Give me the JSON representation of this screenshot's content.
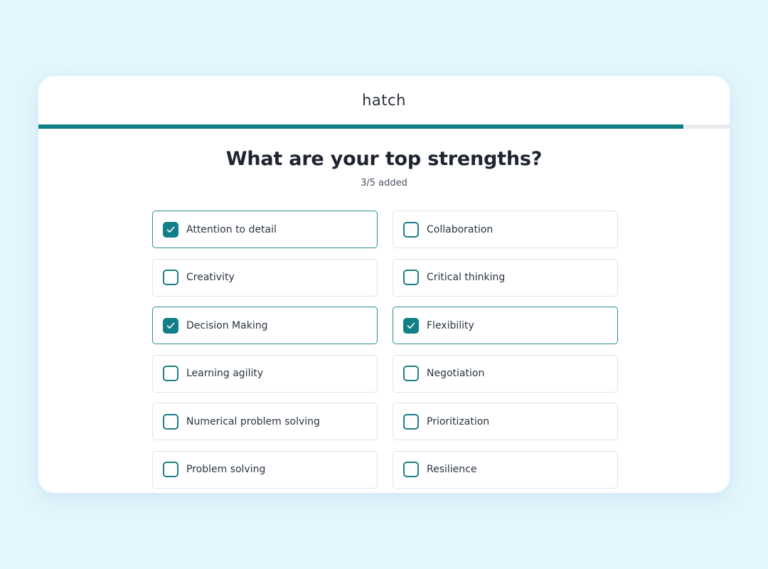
{
  "app": {
    "brand": "hatch",
    "progress": 0.933
  },
  "question": {
    "title": "What are your top strengths?",
    "status": "3/5 added"
  },
  "options": [
    {
      "label": "Attention to detail",
      "checked": true
    },
    {
      "label": "Collaboration",
      "checked": false
    },
    {
      "label": "Creativity",
      "checked": false
    },
    {
      "label": "Critical thinking",
      "checked": false
    },
    {
      "label": "Decision Making",
      "checked": true
    },
    {
      "label": "Flexibility",
      "checked": true
    },
    {
      "label": "Learning agility",
      "checked": false
    },
    {
      "label": "Negotiation",
      "checked": false
    },
    {
      "label": "Numerical problem solving",
      "checked": false
    },
    {
      "label": "Prioritization",
      "checked": false
    },
    {
      "label": "Problem solving",
      "checked": false
    },
    {
      "label": "Resilience",
      "checked": false
    }
  ],
  "colors": {
    "background": "#e3f6fd",
    "accent": "#117f86",
    "card": "#ffffff",
    "border": "#dfe3e8"
  },
  "icons": {
    "checkbox_checked": "check-icon"
  }
}
